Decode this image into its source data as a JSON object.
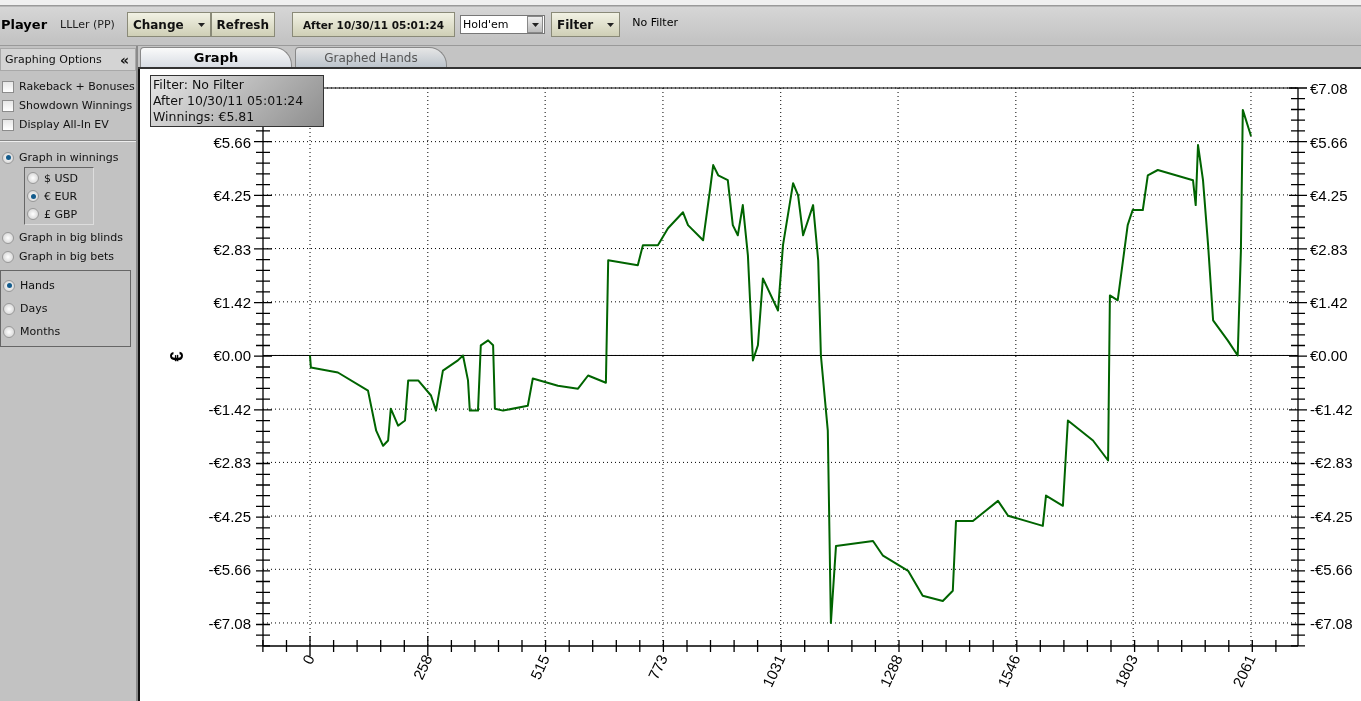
{
  "toolbar": {
    "player_label": "Player",
    "player_name": "LLLer (PP)",
    "buttons": [
      {
        "label": "Change",
        "kind": "dropdown"
      },
      {
        "label": "Refresh",
        "kind": "plain"
      }
    ],
    "date_button": "After 10/30/11 05:01:24",
    "game_select": {
      "value": "Hold'em"
    },
    "filter_button": {
      "label": "Filter",
      "kind": "dropdown"
    },
    "filter_status": "No Filter"
  },
  "sidebar": {
    "title": "Graphing Options",
    "collapse": "«",
    "checkboxes": [
      {
        "label": "Rakeback + Bonuses",
        "checked": false
      },
      {
        "label": "Showdown Winnings",
        "checked": false
      },
      {
        "label": "Display All-In EV",
        "checked": false
      }
    ],
    "graph_modes": [
      {
        "label": "Graph in winnings",
        "selected": true,
        "children": [
          {
            "label": "$ USD",
            "selected": false
          },
          {
            "label": "€ EUR",
            "selected": true
          },
          {
            "label": "£ GBP",
            "selected": false
          }
        ]
      },
      {
        "label": "Graph in big blinds",
        "selected": false
      },
      {
        "label": "Graph in big bets",
        "selected": false
      }
    ],
    "periods": [
      {
        "label": "Hands",
        "selected": true
      },
      {
        "label": "Days",
        "selected": false
      },
      {
        "label": "Months",
        "selected": false
      }
    ]
  },
  "tabs": [
    {
      "label": "Graph",
      "selected": true
    },
    {
      "label": "Graphed Hands",
      "selected": false
    }
  ],
  "graph": {
    "tooltip": [
      "Filter: No Filter",
      "After 10/30/11 05:01:24",
      "Winnings: €5.81"
    ],
    "chart_data": {
      "type": "line",
      "ylabel": "€",
      "grid": true,
      "xlim": [
        -103,
        2164
      ],
      "ylim": [
        -7.69,
        7.08
      ],
      "xticks": [
        0,
        258,
        515,
        773,
        1031,
        1288,
        1546,
        1803,
        2061
      ],
      "yticks": [
        {
          "value": 7.08,
          "label": "€7.08"
        },
        {
          "value": 5.66,
          "label": "€5.66"
        },
        {
          "value": 4.25,
          "label": "€4.25"
        },
        {
          "value": 2.83,
          "label": "€2.83"
        },
        {
          "value": 1.42,
          "label": "€1.42"
        },
        {
          "value": 0,
          "label": "€0.00"
        },
        {
          "value": -1.42,
          "label": "-€1.42"
        },
        {
          "value": -2.83,
          "label": "-€2.83"
        },
        {
          "value": -4.25,
          "label": "-€4.25"
        },
        {
          "value": -5.66,
          "label": "-€5.66"
        },
        {
          "value": -7.08,
          "label": "-€7.08"
        }
      ],
      "x": [
        0,
        2,
        61,
        127,
        145,
        160,
        171,
        177,
        193,
        208,
        215,
        237,
        265,
        276,
        291,
        324,
        335,
        346,
        350,
        368,
        374,
        390,
        401,
        405,
        423,
        477,
        488,
        543,
        587,
        609,
        648,
        653,
        718,
        729,
        762,
        784,
        817,
        828,
        861,
        876,
        883,
        894,
        915,
        926,
        937,
        948,
        959,
        970,
        981,
        992,
        1025,
        1036,
        1058,
        1069,
        1080,
        1102,
        1113,
        1119,
        1134,
        1141,
        1152,
        1233,
        1255,
        1310,
        1342,
        1386,
        1408,
        1415,
        1452,
        1507,
        1529,
        1605,
        1612,
        1649,
        1660,
        1715,
        1748,
        1752,
        1769,
        1791,
        1802,
        1824,
        1835,
        1857,
        1934,
        1940,
        1945,
        1956,
        1967,
        1978,
        2010,
        2032,
        2039,
        2043,
        2061
      ],
      "series": [
        {
          "color": "#006400",
          "values": [
            0,
            -0.32,
            -0.45,
            -0.93,
            -1.99,
            -2.39,
            -2.25,
            -1.41,
            -1.86,
            -1.72,
            -0.66,
            -0.66,
            -1.06,
            -1.46,
            -0.4,
            -0.13,
            0,
            -0.66,
            -1.46,
            -1.46,
            0.27,
            0.4,
            0.27,
            -1.41,
            -1.46,
            -1.33,
            -0.61,
            -0.8,
            -0.88,
            -0.53,
            -0.72,
            2.52,
            2.39,
            2.92,
            2.92,
            3.37,
            3.79,
            3.45,
            3.05,
            4.38,
            5.04,
            4.77,
            4.64,
            3.45,
            3.18,
            3.98,
            2.65,
            -0.13,
            0.27,
            2.04,
            1.19,
            2.92,
            4.56,
            4.24,
            3.18,
            3.98,
            2.52,
            0,
            -1.99,
            -7.08,
            -5.04,
            -4.91,
            -5.3,
            -5.7,
            -6.36,
            -6.5,
            -6.23,
            -4.38,
            -4.38,
            -3.85,
            -4.24,
            -4.51,
            -3.71,
            -3.98,
            -1.72,
            -2.25,
            -2.78,
            1.59,
            1.46,
            3.45,
            3.85,
            3.85,
            4.77,
            4.91,
            4.64,
            3.98,
            5.57,
            4.64,
            2.92,
            0.93,
            0.4,
            0,
            2.78,
            6.5,
            5.81
          ]
        }
      ]
    }
  }
}
